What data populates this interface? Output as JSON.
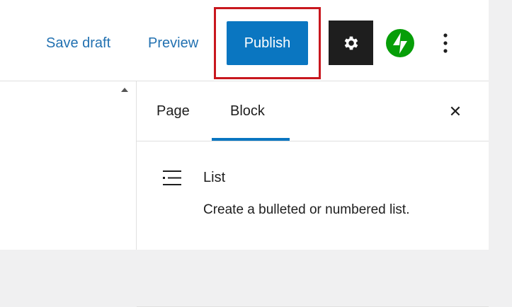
{
  "header": {
    "save_draft_label": "Save draft",
    "preview_label": "Preview",
    "publish_label": "Publish",
    "more_icon": "vertical-ellipsis-icon",
    "settings_icon": "gear-icon",
    "jetpack_icon": "jetpack-bolt-icon"
  },
  "sidebar": {
    "tabs": [
      {
        "label": "Page",
        "active": false
      },
      {
        "label": "Block",
        "active": true
      }
    ],
    "close_label": "✕",
    "block": {
      "icon": "list-icon",
      "title": "List",
      "description": "Create a bulleted or numbered list."
    }
  },
  "colors": {
    "accent": "#0a76c1",
    "link": "#2271b1",
    "highlight_border": "#c8171e",
    "jetpack_green": "#069e08",
    "settings_bg": "#1e1e1e"
  }
}
